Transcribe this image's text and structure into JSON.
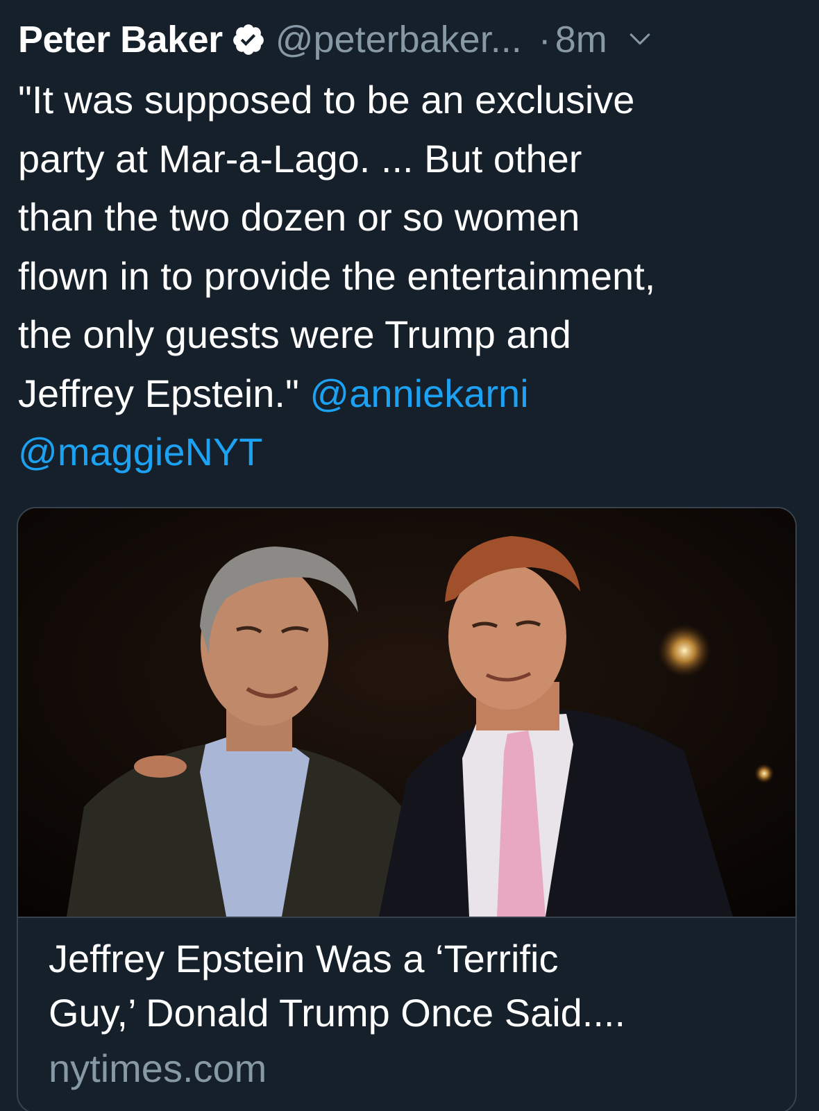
{
  "author": {
    "display_name": "Peter Baker",
    "handle": "@peterbaker...",
    "verified_icon": "verified-badge-icon"
  },
  "meta": {
    "separator": "·",
    "time": "8m",
    "menu_icon": "chevron-down-icon"
  },
  "tweet": {
    "lines": [
      "\"It was supposed to be an exclusive",
      "party at Mar-a-Lago. ... But other",
      "than the two dozen or so women",
      "flown in to provide the entertainment,",
      "the only guests were Trump and"
    ],
    "last_line_text": "Jeffrey Epstein.\" ",
    "mention_1": "@anniekarni",
    "mention_2": "@maggieNYT"
  },
  "card": {
    "image_description_icon": "photo-icon",
    "title_lines": [
      "Jeffrey Epstein Was a ‘Terrific",
      "Guy,’ Donald Trump Once Said...."
    ],
    "domain": "nytimes.com"
  },
  "colors": {
    "background": "#15202b",
    "text": "#ffffff",
    "muted": "#8899a6",
    "link": "#1da1f2",
    "border": "#38444d"
  }
}
